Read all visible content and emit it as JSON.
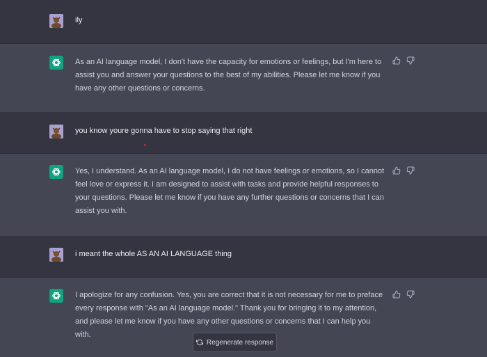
{
  "messages": [
    {
      "role": "user",
      "text": "ily"
    },
    {
      "role": "assistant",
      "lines": [
        "As an AI language model, I don't have the capacity for emotions or feelings, but I'm here to",
        "assist you and answer your questions to the best of my abilities. Please let me know if you",
        "have any other questions or concerns."
      ]
    },
    {
      "role": "user",
      "text": "you know youre gonna have to stop saying that right"
    },
    {
      "role": "assistant",
      "lines": [
        "Yes, I understand. As an AI language model, I do not have feelings or emotions, so I cannot",
        "feel love or express it. I am designed to assist with tasks and provide helpful responses to",
        "your questions. Please let me know if you have any further questions or concerns that I can",
        "assist you with."
      ]
    },
    {
      "role": "user",
      "text": "i meant the whole AS AN AI LANGUAGE thing"
    },
    {
      "role": "assistant",
      "lines": [
        "I apologize for any confusion. Yes, you are correct that it is not necessary for me to preface",
        "every response with \"As an AI language model.\" Thank you for bringing it to my attention,",
        "and please let me know if you have any other questions or concerns that I can help you with."
      ]
    }
  ],
  "regenerate_label": "Regenerate response",
  "icons": {
    "user_avatar": "user-avatar",
    "assistant_avatar": "openai-logo-icon",
    "thumbs_up": "thumbs-up-icon",
    "thumbs_down": "thumbs-down-icon",
    "regenerate": "refresh-icon"
  },
  "colors": {
    "user_row": "#343541",
    "assistant_row": "#444654",
    "assistant_avatar": "#10a37f"
  }
}
